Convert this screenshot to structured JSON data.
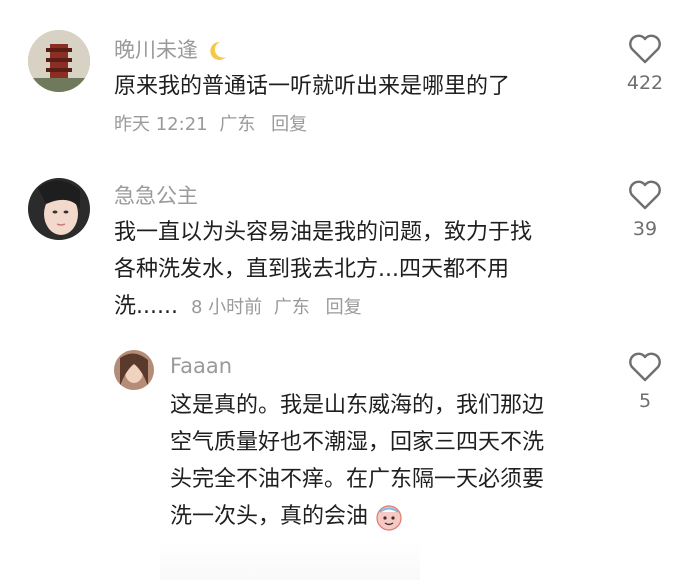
{
  "comments": [
    {
      "username": "晚川未逢",
      "text_lines": [
        "原来我的普通话一听就听出来是哪里的了"
      ],
      "meta": {
        "time": "昨天 12:21",
        "location": "广东",
        "reply": "回复"
      },
      "likes": "422",
      "avatar_icon": "tower-landscape-avatar"
    },
    {
      "username": "急急公主",
      "text_lines": [
        "我一直以为头容易油是我的问题，致力于找",
        "各种洗发水，直到我去北方...四天都不用",
        "洗......"
      ],
      "meta": {
        "time": "8 小时前",
        "location": "广东",
        "reply": "回复"
      },
      "likes": "39",
      "avatar_icon": "girl-face-avatar"
    },
    {
      "username": "Faaan",
      "text_lines": [
        "这是真的。我是山东威海的，我们那边",
        "空气质量好也不潮湿，回家三四天不洗",
        "头完全不油不痒。在广东隔一天必须要",
        "洗一次头，真的会油"
      ],
      "likes": "5",
      "avatar_icon": "woman-portrait-avatar"
    }
  ],
  "username_moon_icon": "crescent-moon-icon",
  "colors": {
    "username": "#9a9a9a",
    "text": "#1f1f1f",
    "meta": "#9a9a9a",
    "like": "#6f6f6f"
  }
}
